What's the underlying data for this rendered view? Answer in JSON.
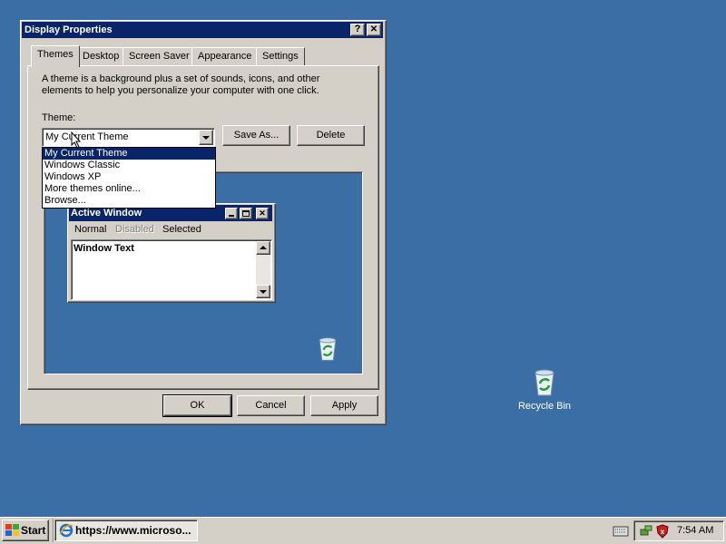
{
  "dialog": {
    "title": "Display Properties",
    "help_label": "?",
    "close_label": "✕",
    "tabs": [
      "Themes",
      "Desktop",
      "Screen Saver",
      "Appearance",
      "Settings"
    ],
    "description": "A theme is a background plus a set of sounds, icons, and other elements to help you personalize your computer with one click.",
    "theme_label": "Theme:",
    "theme_selected": "My Current Theme",
    "theme_options": [
      "My Current Theme",
      "Windows Classic",
      "Windows XP",
      "More themes online...",
      "Browse..."
    ],
    "save_as_label": "Save As...",
    "delete_label": "Delete",
    "ok_label": "OK",
    "cancel_label": "Cancel",
    "apply_label": "Apply"
  },
  "preview": {
    "window_title": "Active Window",
    "menu": [
      "Normal",
      "Disabled",
      "Selected"
    ],
    "window_text": "Window Text"
  },
  "desktop": {
    "recycle_bin_label": "Recycle Bin"
  },
  "taskbar": {
    "start_label": "Start",
    "task_label": "https://www.microso...",
    "clock": "7:54 AM"
  }
}
